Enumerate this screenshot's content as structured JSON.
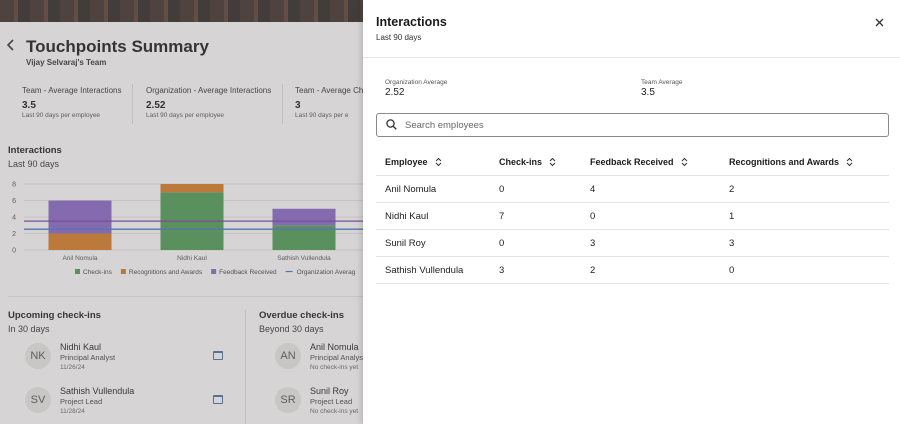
{
  "background_page": {
    "title": "Touchpoints Summary",
    "subtitle": "Vijay Selvaraj's Team",
    "metrics": [
      {
        "label": "Team - Average Interactions",
        "value": "3.5",
        "sub": "Last 90 days per employee"
      },
      {
        "label": "Organization - Average Interactions",
        "value": "2.52",
        "sub": "Last 90 days per employee"
      },
      {
        "label": "Team - Average Che",
        "value": "3",
        "sub": "Last 90 days per e"
      }
    ],
    "interactions_section": {
      "title": "Interactions",
      "subtitle": "Last 90 days"
    },
    "upcoming": {
      "title": "Upcoming check-ins",
      "subtitle": "In 30 days",
      "people": [
        {
          "initials": "NK",
          "name": "Nidhi Kaul",
          "role": "Principal Analyst",
          "date": "11/26/24"
        },
        {
          "initials": "SV",
          "name": "Sathish Vullendula",
          "role": "Project Lead",
          "date": "11/28/24"
        }
      ]
    },
    "overdue": {
      "title": "Overdue check-ins",
      "subtitle": "Beyond 30 days",
      "people": [
        {
          "initials": "AN",
          "name": "Anil Nomula",
          "role": "Principal Analys",
          "date": "No check-ins yet"
        },
        {
          "initials": "SR",
          "name": "Sunil Roy",
          "role": "Project Lead",
          "date": "No check-ins yet"
        }
      ]
    }
  },
  "chart_data": {
    "type": "bar",
    "stacked": true,
    "categories": [
      "Anil Nomula",
      "Nidhi Kaul",
      "Sathish Vullendula"
    ],
    "series": [
      {
        "name": "Check-ins",
        "values": [
          0,
          7,
          3
        ],
        "color": "#4f9a55"
      },
      {
        "name": "Recognitions and Awards",
        "values": [
          2,
          1,
          0
        ],
        "color": "#d67b26"
      },
      {
        "name": "Feedback Received",
        "values": [
          4,
          0,
          2
        ],
        "color": "#8a67c7"
      }
    ],
    "reference_lines": [
      {
        "name": "Organization Averag",
        "value": 2.52,
        "color": "#4a74c9"
      },
      {
        "name": "Team Average",
        "value": 3.5,
        "color": "#7e3fa3"
      }
    ],
    "yticks": [
      "0",
      "2",
      "4",
      "6",
      "8"
    ],
    "ylim": [
      0,
      8
    ],
    "grid": true,
    "legend_position": "bottom"
  },
  "drawer": {
    "title": "Interactions",
    "subtitle": "Last 90 days",
    "close_icon": "close-icon",
    "org_avg": {
      "label": "Organization Average",
      "value": "2.52"
    },
    "team_avg": {
      "label": "Team Average",
      "value": "3.5"
    },
    "search": {
      "placeholder": "Search employees",
      "value": ""
    },
    "columns": [
      "Employee",
      "Check-ins",
      "Feedback Received",
      "Recognitions and Awards"
    ],
    "rows": [
      [
        "Anil Nomula",
        "0",
        "4",
        "2"
      ],
      [
        "Nidhi Kaul",
        "7",
        "0",
        "1"
      ],
      [
        "Sunil Roy",
        "0",
        "3",
        "3"
      ],
      [
        "Sathish Vullendula",
        "3",
        "2",
        "0"
      ]
    ]
  },
  "colors": {
    "accent": "#4a6fa5",
    "border": "#8a8a8a"
  }
}
